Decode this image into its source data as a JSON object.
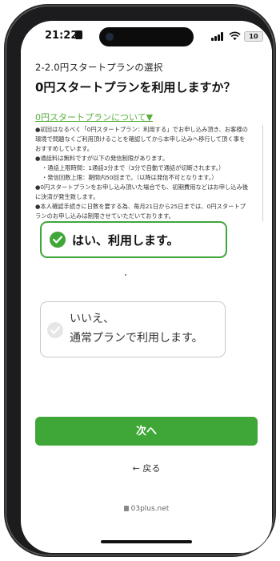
{
  "status_bar": {
    "time": "21:22",
    "battery": "10",
    "icons": [
      "lock-icon",
      "signal-icon",
      "wifi-icon",
      "battery-icon"
    ]
  },
  "page": {
    "step_title": "2-2.0円スタートプランの選択",
    "question": "0円スタートプランを利用しますか？",
    "about_link": "0円スタートプランについて▼",
    "notes": [
      "●初回はなるべく「0円スタートプラン：利用する」でお申し込み頂き、お客様の",
      "環境で問題なくご利用頂けることを確認してから本申し込みへ移行して頂く事を",
      "おすすめしています。",
      "●通話料は無料ですが以下の発信制限があります。",
      "・通話上限時間：1通話3分まで（3分で自動で通話が切断されます。）",
      "・発信回数上限：期間内50回まで。（以降は発信不可となります。）",
      "●0円スタートプランをお申し込み頂いた場合でも、初期費用などはお申し込み後",
      "に決済が発生致します。",
      "●本人確認手続きに日数を要する為、毎月21日から25日までは、0円スタートプ",
      "ランのお申し込みは制限させていただいております。"
    ],
    "option_yes": "はい、利用します。",
    "option_no_line1": "いいえ、",
    "option_no_line2": "通常プランで利用します。",
    "next_button": "次へ",
    "back_link": "← 戻る"
  },
  "browser": {
    "url": "03plus.net"
  },
  "colors": {
    "accent": "#3fa638",
    "link": "#5bae3f"
  }
}
